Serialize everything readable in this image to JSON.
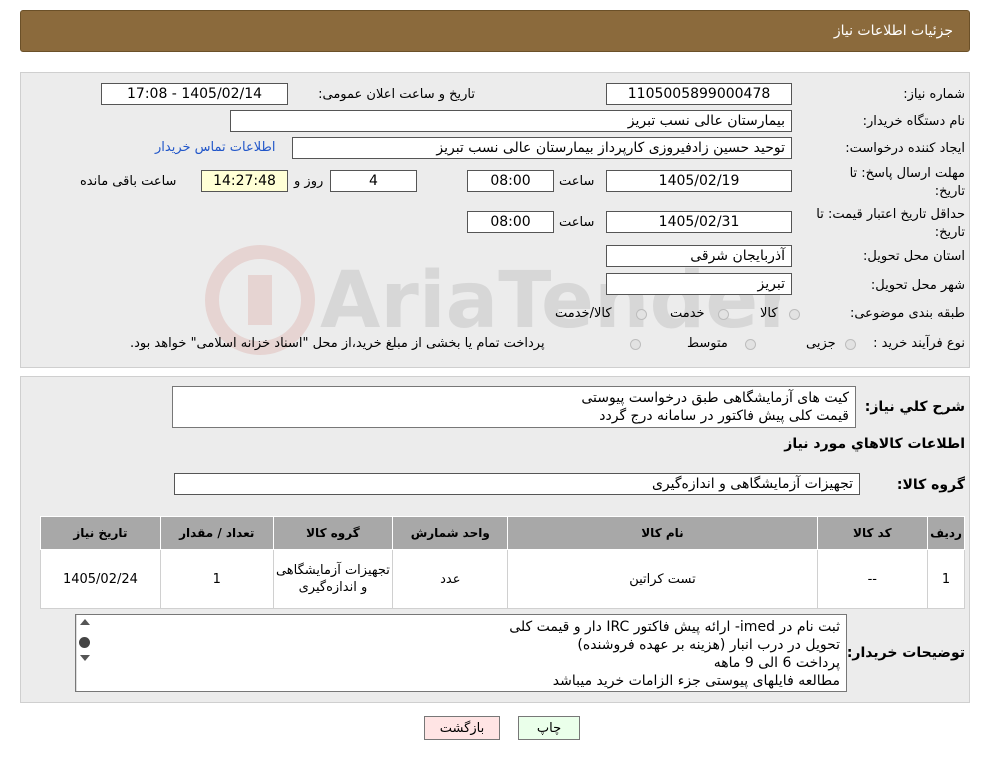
{
  "header": {
    "title": "جزئیات اطلاعات نیاز"
  },
  "fields": {
    "need_number_label": "شماره نیاز:",
    "need_number": "1105005899000478",
    "announce_label": "تاریخ و ساعت اعلان عمومی:",
    "announce_value": "1405/02/14 - 17:08",
    "buyer_label": "نام دستگاه خریدار:",
    "buyer_value": "بیمارستان عالی نسب تبریز",
    "creator_label": "ایجاد کننده درخواست:",
    "creator_value": "توحید حسین زادفیروزی کارپرداز بیمارستان عالی نسب تبریز",
    "contact_link": "اطلاعات تماس خریدار",
    "deadline_label_1": "مهلت ارسال پاسخ: تا",
    "deadline_label_2": "تاریخ:",
    "deadline_date": "1405/02/19",
    "time_label": "ساعت",
    "deadline_time": "08:00",
    "days_value": "4",
    "days_label": "روز و",
    "remaining_time": "14:27:48",
    "remaining_label": "ساعت باقی مانده",
    "validity_label_1": "حداقل تاریخ اعتبار قیمت: تا",
    "validity_label_2": "تاریخ:",
    "validity_date": "1405/02/31",
    "validity_time_label": "ساعت",
    "validity_time": "08:00",
    "province_label": "استان محل تحویل:",
    "province_value": "آذربایجان شرقی",
    "city_label": "شهر محل تحویل:",
    "city_value": "تبریز",
    "category_label": "طبقه بندی موضوعی:",
    "category_options": [
      "کالا",
      "خدمت",
      "کالا/خدمت"
    ],
    "process_label": "نوع فرآیند خرید :",
    "process_options": [
      "جزیی",
      "متوسط"
    ],
    "process_note": "پرداخت تمام یا بخشی از مبلغ خرید،از محل \"اسناد خزانه اسلامی\" خواهد بود."
  },
  "summary": {
    "label": "شرح کلي نياز:",
    "line1": "کیت های آزمایشگاهی طبق درخواست پیوستی",
    "line2": "قیمت کلی پیش فاکتور در سامانه درج گردد"
  },
  "goods": {
    "section_title": "اطلاعات کالاهاي مورد نياز",
    "group_label": "گروه کالا:",
    "group_value": "تجهیزات آزمایشگاهی و اندازه‌گیری"
  },
  "table": {
    "headers": [
      "ردیف",
      "کد کالا",
      "نام کالا",
      "واحد شمارش",
      "گروه کالا",
      "تعداد / مقدار",
      "تاریخ نیاز"
    ],
    "rows": [
      {
        "row": "1",
        "code": "--",
        "name": "تست کراتین",
        "unit": "عدد",
        "group": "تجهیزات آزمایشگاهی و اندازه‌گیری",
        "qty": "1",
        "date": "1405/02/24"
      }
    ]
  },
  "buyer_notes": {
    "label": "توضیحات خریدار:",
    "line1": "ثبت نام در imed- ارائه پیش فاکتور IRC دار و قیمت کلی",
    "line2": "تحویل در درب انبار (هزینه بر عهده فروشنده)",
    "line3": "پرداخت  6 الی 9 ماهه",
    "line4": "مطالعه فایلهای پیوستی جزء الزامات خرید میباشد"
  },
  "buttons": {
    "print": "چاپ",
    "back": "بازگشت"
  },
  "colors": {
    "header": "#8b6a3c",
    "panel": "#ececec",
    "link": "#2156c9",
    "print_btn": "#eaffea",
    "back_btn": "#ffe4e4"
  }
}
